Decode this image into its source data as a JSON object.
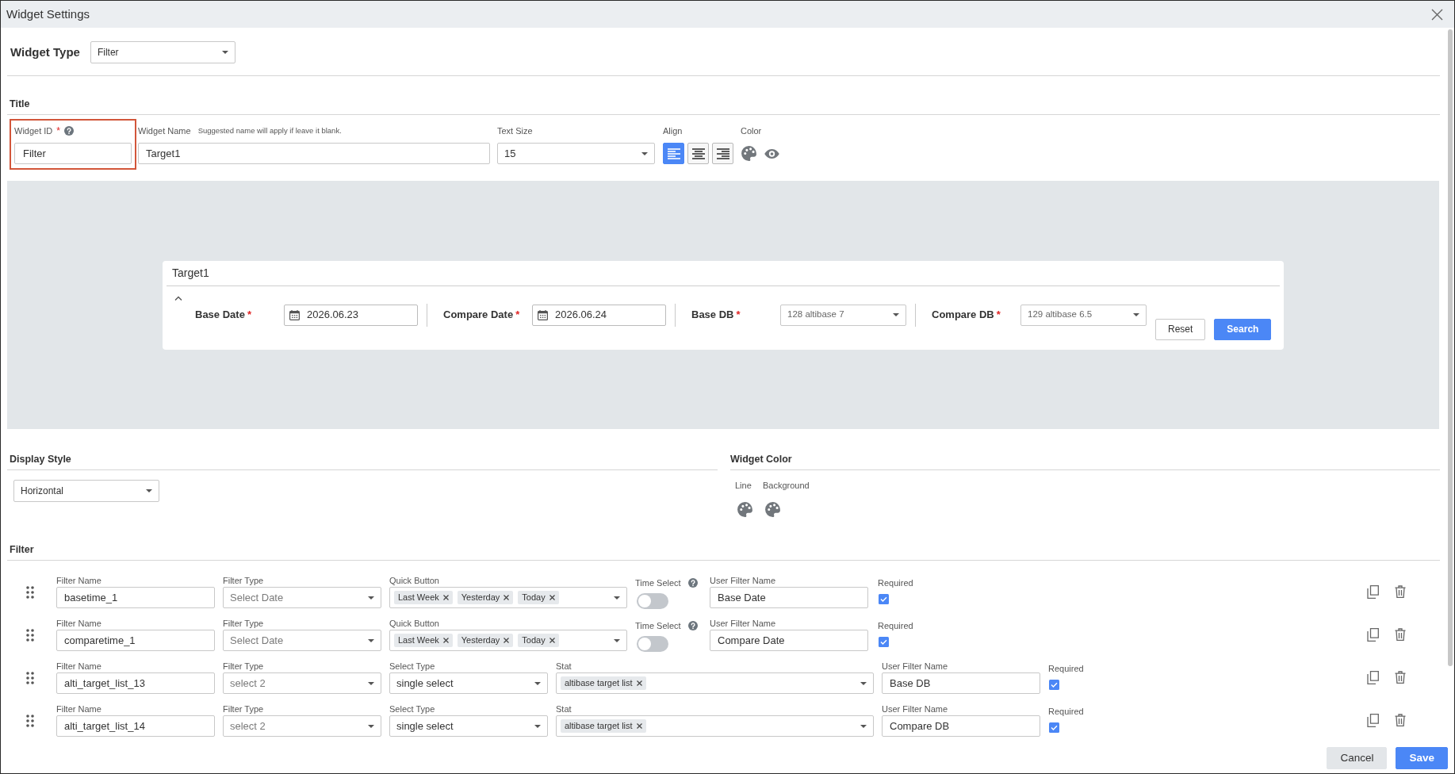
{
  "window": {
    "title": "Widget Settings"
  },
  "widget_type": {
    "label": "Widget Type",
    "value": "Filter"
  },
  "title_section": {
    "heading": "Title",
    "widget_id": {
      "label": "Widget ID",
      "mark": "*",
      "value": "Filter",
      "highlighted": true
    },
    "widget_name": {
      "label": "Widget Name",
      "hint": "Suggested name will apply if leave it blank.",
      "value": "Target1"
    },
    "text_size": {
      "label": "Text Size",
      "value": "15"
    },
    "align": {
      "label": "Align",
      "options": [
        {
          "kind": "left",
          "selected": true
        },
        {
          "kind": "center",
          "selected": false
        },
        {
          "kind": "right",
          "selected": false
        }
      ]
    },
    "color": {
      "label": "Color"
    }
  },
  "preview": {
    "title": "Target1",
    "fields": [
      {
        "kind": "date",
        "label": "Base Date",
        "mark": "*",
        "value": "2026.06.23"
      },
      {
        "kind": "date",
        "label": "Compare Date",
        "mark": "*",
        "value": "2026.06.24"
      },
      {
        "kind": "select",
        "label": "Base DB",
        "mark": "*",
        "value": "128 altibase 7"
      },
      {
        "kind": "select",
        "label": "Compare DB",
        "mark": "*",
        "value": "129 altibase 6.5"
      }
    ],
    "buttons": [
      {
        "kind": "outline",
        "label": "Reset"
      },
      {
        "kind": "primary",
        "label": "Search"
      }
    ]
  },
  "display_style": {
    "heading": "Display Style",
    "value": "Horizontal"
  },
  "widget_color": {
    "heading": "Widget Color",
    "items": [
      {
        "label": "Line"
      },
      {
        "label": "Background"
      }
    ]
  },
  "filter": {
    "heading": "Filter",
    "rows": [
      {
        "kind": "date",
        "filter_name": {
          "label": "Filter Name",
          "value": "basetime_1"
        },
        "filter_type": {
          "label": "Filter Type",
          "value": "Select Date",
          "disabled": true
        },
        "quick_button": {
          "label": "Quick Button",
          "tags": [
            "Last Week",
            "Yesterday",
            "Today"
          ]
        },
        "time_select": {
          "label": "Time Select",
          "on": false
        },
        "user_filter_name": {
          "label": "User Filter Name",
          "value": "Base Date"
        },
        "required": {
          "label": "Required",
          "checked": true
        }
      },
      {
        "kind": "date",
        "filter_name": {
          "label": "Filter Name",
          "value": "comparetime_1"
        },
        "filter_type": {
          "label": "Filter Type",
          "value": "Select Date",
          "disabled": true
        },
        "quick_button": {
          "label": "Quick Button",
          "tags": [
            "Last Week",
            "Yesterday",
            "Today"
          ]
        },
        "time_select": {
          "label": "Time Select",
          "on": false
        },
        "user_filter_name": {
          "label": "User Filter Name",
          "value": "Compare Date"
        },
        "required": {
          "label": "Required",
          "checked": true
        }
      },
      {
        "kind": "select",
        "filter_name": {
          "label": "Filter Name",
          "value": "alti_target_list_13"
        },
        "filter_type": {
          "label": "Filter Type",
          "value": "select 2",
          "disabled": true
        },
        "select_type": {
          "label": "Select Type",
          "value": "single select"
        },
        "stat": {
          "label": "Stat",
          "tags": [
            "altibase target list"
          ]
        },
        "user_filter_name": {
          "label": "User Filter Name",
          "value": "Base DB"
        },
        "required": {
          "label": "Required",
          "checked": true
        }
      },
      {
        "kind": "select",
        "filter_name": {
          "label": "Filter Name",
          "value": "alti_target_list_14"
        },
        "filter_type": {
          "label": "Filter Type",
          "value": "select 2",
          "disabled": true
        },
        "select_type": {
          "label": "Select Type",
          "value": "single select"
        },
        "stat": {
          "label": "Stat",
          "tags": [
            "altibase target list"
          ]
        },
        "user_filter_name": {
          "label": "User Filter Name",
          "value": "Compare DB"
        },
        "required": {
          "label": "Required",
          "checked": true
        }
      }
    ]
  },
  "footer": {
    "buttons": [
      {
        "kind": "light",
        "label": "Cancel"
      },
      {
        "kind": "primary",
        "label": "Save"
      }
    ]
  }
}
